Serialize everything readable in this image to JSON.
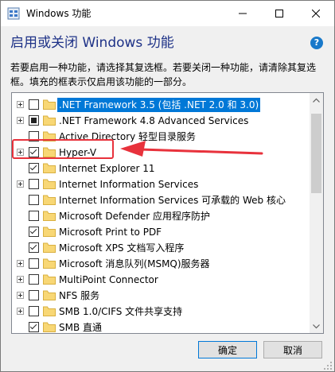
{
  "window": {
    "title": "Windows 功能"
  },
  "header": {
    "heading": "启用或关闭 Windows 功能",
    "description": "若要启用一种功能，请选择其复选框。若要关闭一种功能，请清除其复选框。填充的框表示仅启用该功能的一部分。"
  },
  "features": [
    {
      "label": ".NET Framework 3.5 (包括 .NET 2.0 和 3.0)",
      "state": "unchecked",
      "expandable": true,
      "selected": true
    },
    {
      "label": ".NET Framework 4.8 Advanced Services",
      "state": "partial",
      "expandable": true,
      "selected": false
    },
    {
      "label": "Active Directory 轻型目录服务",
      "state": "unchecked",
      "expandable": false,
      "selected": false
    },
    {
      "label": "Hyper-V",
      "state": "checked",
      "expandable": true,
      "selected": false
    },
    {
      "label": "Internet Explorer 11",
      "state": "checked",
      "expandable": false,
      "selected": false
    },
    {
      "label": "Internet Information Services",
      "state": "unchecked",
      "expandable": true,
      "selected": false
    },
    {
      "label": "Internet Information Services 可承载的 Web 核心",
      "state": "unchecked",
      "expandable": false,
      "selected": false
    },
    {
      "label": "Microsoft Defender 应用程序防护",
      "state": "unchecked",
      "expandable": false,
      "selected": false
    },
    {
      "label": "Microsoft Print to PDF",
      "state": "checked",
      "expandable": false,
      "selected": false
    },
    {
      "label": "Microsoft XPS 文档写入程序",
      "state": "checked",
      "expandable": false,
      "selected": false
    },
    {
      "label": "Microsoft 消息队列(MSMQ)服务器",
      "state": "unchecked",
      "expandable": true,
      "selected": false
    },
    {
      "label": "MultiPoint Connector",
      "state": "unchecked",
      "expandable": true,
      "selected": false
    },
    {
      "label": "NFS 服务",
      "state": "unchecked",
      "expandable": true,
      "selected": false
    },
    {
      "label": "SMB 1.0/CIFS 文件共享支持",
      "state": "unchecked",
      "expandable": true,
      "selected": false
    },
    {
      "label": "SMB 直通",
      "state": "checked",
      "expandable": false,
      "selected": false
    }
  ],
  "buttons": {
    "ok": "确定",
    "cancel": "取消"
  },
  "colors": {
    "accent": "#0078d7",
    "annotation": "#e8323c",
    "heading": "#1e3287"
  }
}
